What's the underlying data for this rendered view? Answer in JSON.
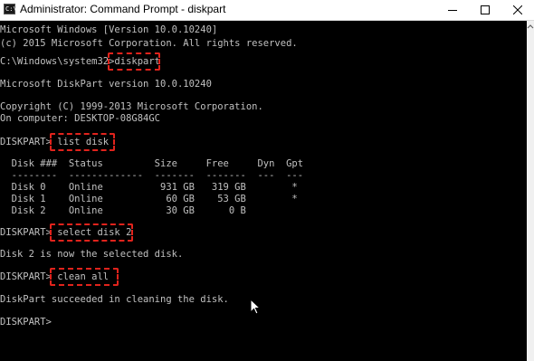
{
  "window": {
    "title": "Administrator: Command Prompt - diskpart",
    "icon_label": "C:\\",
    "controls": [
      "minimize-icon",
      "maximize-icon",
      "close-icon"
    ]
  },
  "console": {
    "lines": [
      "Microsoft Windows [Version 10.0.10240]",
      "(c) 2015 Microsoft Corporation. All rights reserved.",
      "",
      "C:\\Windows\\system32>diskpart",
      "",
      "Microsoft DiskPart version 10.0.10240",
      "",
      "Copyright (C) 1999-2013 Microsoft Corporation.",
      "On computer: DESKTOP-08G84GC",
      "",
      "DISKPART> list disk",
      "",
      "  Disk ###  Status         Size     Free     Dyn  Gpt",
      "  --------  -------------  -------  -------  ---  ---",
      "  Disk 0    Online          931 GB   319 GB        *",
      "  Disk 1    Online           60 GB    53 GB        *",
      "  Disk 2    Online           30 GB      0 B",
      "",
      "DISKPART> select disk 2",
      "",
      "Disk 2 is now the selected disk.",
      "",
      "DISKPART> clean all",
      "",
      "DiskPart succeeded in cleaning the disk.",
      "",
      "DISKPART> "
    ],
    "highlighted_commands": [
      "diskpart",
      "list disk",
      "select disk 2",
      "clean all"
    ],
    "text_color": "#c0c0c0",
    "background_color": "#000000",
    "highlight_color": "#e0231c"
  }
}
